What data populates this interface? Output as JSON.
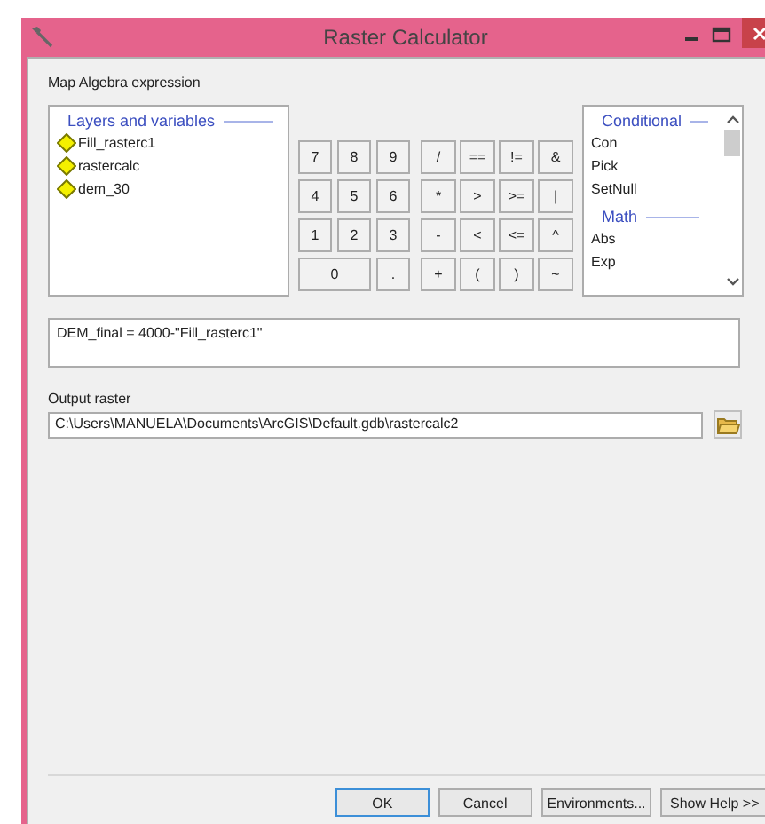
{
  "window": {
    "title": "Raster Calculator"
  },
  "expression_label": "Map Algebra expression",
  "layers": {
    "header": "Layers and variables",
    "items": [
      {
        "name": "Fill_rasterc1"
      },
      {
        "name": "rastercalc"
      },
      {
        "name": "dem_30"
      }
    ]
  },
  "keypad": {
    "digits": [
      {
        "label": "7",
        "wide": false
      },
      {
        "label": "8",
        "wide": false
      },
      {
        "label": "9",
        "wide": false
      },
      {
        "label": "4",
        "wide": false
      },
      {
        "label": "5",
        "wide": false
      },
      {
        "label": "6",
        "wide": false
      },
      {
        "label": "1",
        "wide": false
      },
      {
        "label": "2",
        "wide": false
      },
      {
        "label": "3",
        "wide": false
      },
      {
        "label": "0",
        "wide": true
      },
      {
        "label": ".",
        "wide": false
      }
    ],
    "operators": [
      "/",
      "==",
      "!=",
      "&",
      "*",
      ">",
      ">=",
      "|",
      "-",
      "<",
      "<=",
      "^",
      "+",
      "(",
      ")",
      "~"
    ]
  },
  "functions": [
    {
      "header": "Conditional",
      "items": [
        "Con",
        "Pick",
        "SetNull"
      ]
    },
    {
      "header": "Math",
      "items": [
        "Abs",
        "Exp"
      ]
    }
  ],
  "expression": "DEM_final = 4000-\"Fill_rasterc1\"",
  "output": {
    "label": "Output raster",
    "value": "C:\\Users\\MANUELA\\Documents\\ArcGIS\\Default.gdb\\rastercalc2"
  },
  "buttons": [
    {
      "label": "OK",
      "default": true
    },
    {
      "label": "Cancel",
      "default": false
    },
    {
      "label": "Environments...",
      "default": false
    },
    {
      "label": "Show Help >>",
      "default": false
    }
  ]
}
